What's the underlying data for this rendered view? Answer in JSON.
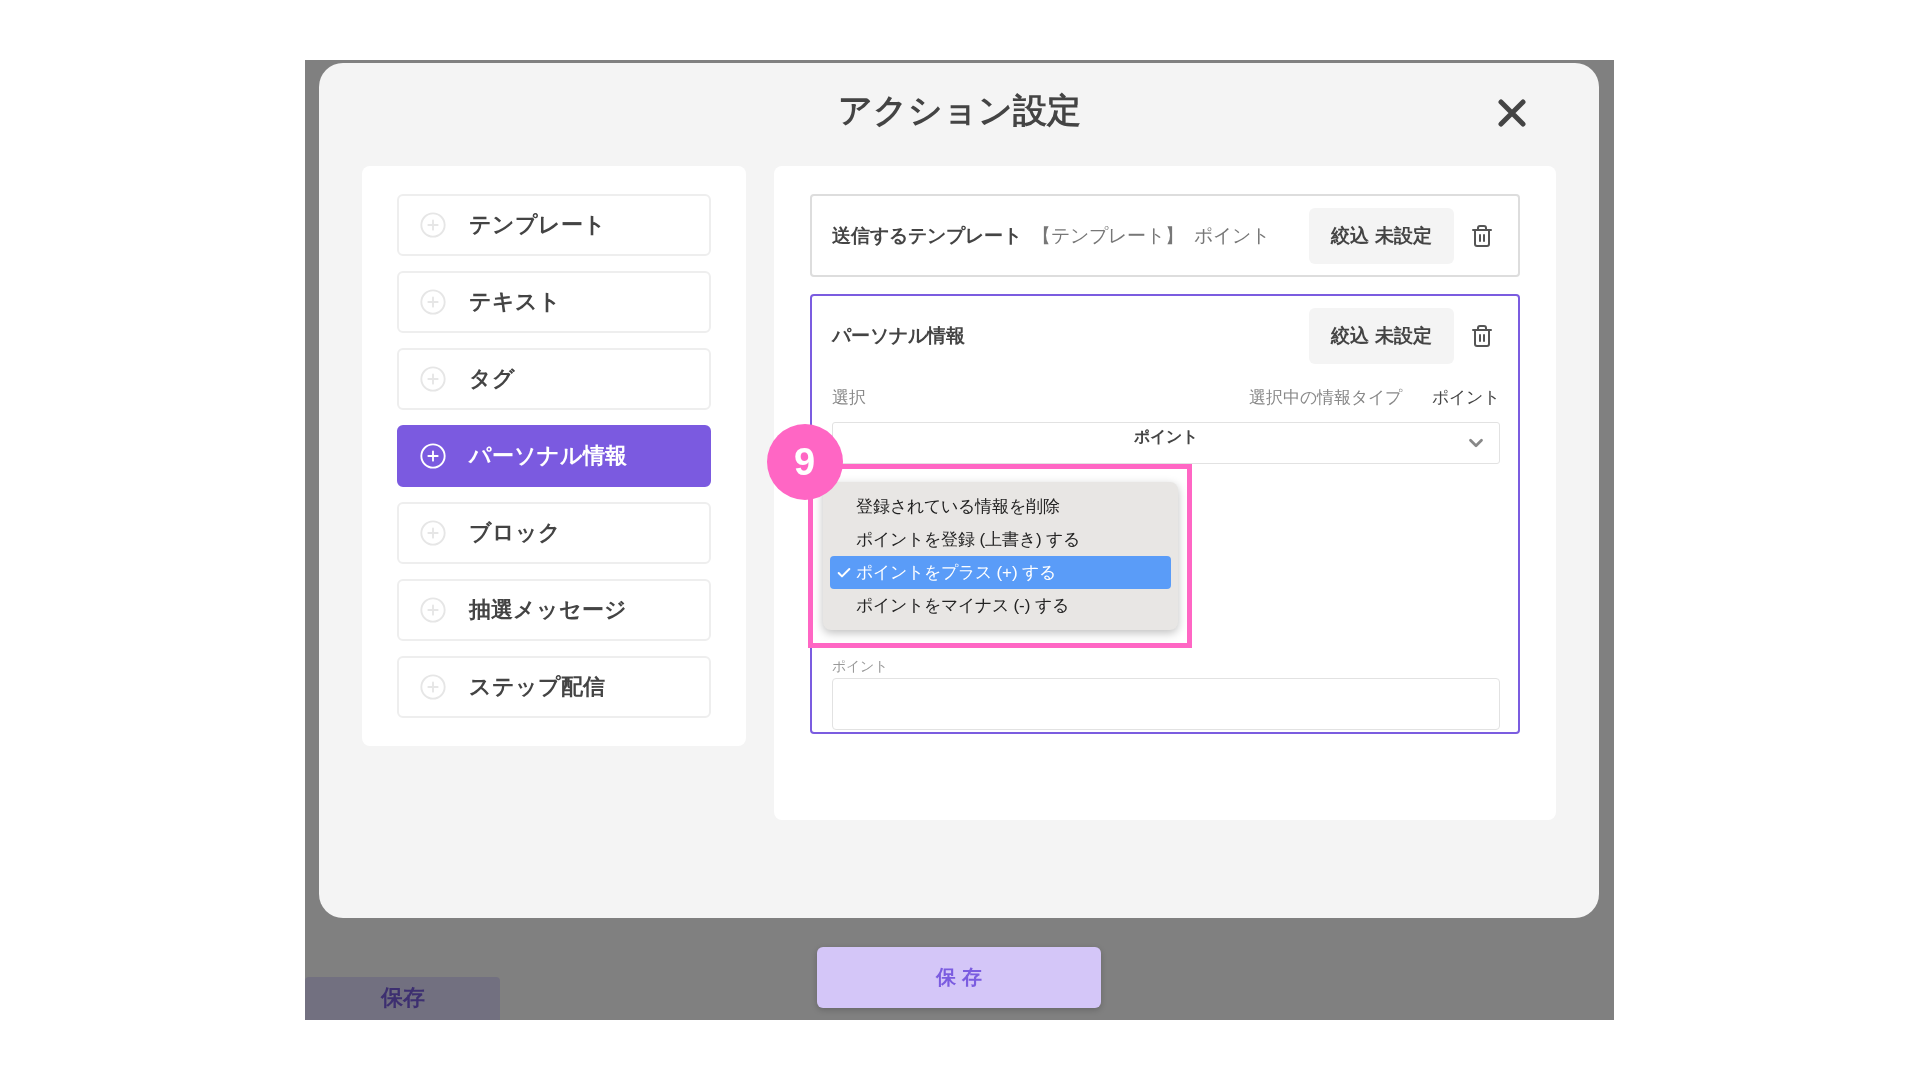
{
  "window": {
    "title": "アクション設定"
  },
  "action_types": [
    {
      "label": "テンプレート",
      "selected": false
    },
    {
      "label": "テキスト",
      "selected": false
    },
    {
      "label": "タグ",
      "selected": false
    },
    {
      "label": "パーソナル情報",
      "selected": true
    },
    {
      "label": "ブロック",
      "selected": false
    },
    {
      "label": "抽選メッセージ",
      "selected": false
    },
    {
      "label": "ステップ配信",
      "selected": false
    }
  ],
  "actions": [
    {
      "kind": "template",
      "title": "送信するテンプレート",
      "template_name": "【テンプレート】",
      "template_type": "ポイント",
      "filter": "絞込 未設定",
      "active": false
    },
    {
      "kind": "personal",
      "title": "パーソナル情報",
      "filter": "絞込 未設定",
      "active": true,
      "select_label": "選択",
      "type_label": "選択中の情報タイプ",
      "type_value": "ポイント",
      "select_value": "ポイント",
      "field_label": "ポイント"
    }
  ],
  "dropdown": {
    "options": [
      {
        "label": "登録されている情報を削除",
        "selected": false
      },
      {
        "label": "ポイントを登録 (上書き) する",
        "selected": false
      },
      {
        "label": "ポイントをプラス (+) する",
        "selected": true
      },
      {
        "label": "ポイントをマイナス (-) する",
        "selected": false
      }
    ]
  },
  "annotation": {
    "number": "9"
  },
  "footer": {
    "save": "保 存"
  },
  "background": {
    "save": "保存"
  }
}
